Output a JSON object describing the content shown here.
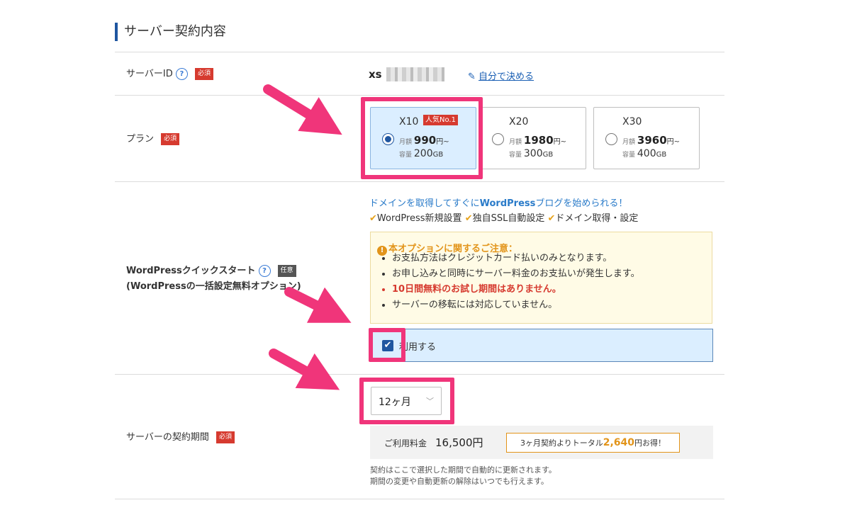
{
  "section": {
    "title": "サーバー契約内容"
  },
  "badges": {
    "required": "必須",
    "optional": "任意",
    "help": "?"
  },
  "server_id": {
    "label": "サーバーID",
    "value_prefix": "xs",
    "edit_link": "自分で決める"
  },
  "plan": {
    "label": "プラン",
    "monthly_label": "月額",
    "capacity_label": "容量",
    "price_unit": "円~",
    "capacity_unit": "GB",
    "popular_badge": "人気No.1",
    "selected": "X10",
    "options": [
      {
        "name": "X10",
        "price": "990",
        "capacity": "200"
      },
      {
        "name": "X20",
        "price": "1980",
        "capacity": "300"
      },
      {
        "name": "X30",
        "price": "3960",
        "capacity": "400"
      }
    ]
  },
  "wordpress": {
    "label": "WordPressクイックスタート",
    "sublabel": "(WordPressの一括設定無料オプション)",
    "headline_pre": "ドメインを取得してすぐに",
    "headline_bold": "WordPress",
    "headline_post": "ブログを始められる！",
    "features": [
      "WordPress新規設置",
      "独自SSL自動設定",
      "ドメイン取得・設定"
    ],
    "notice_title": "本オプションに関するご注意：",
    "notice_items": [
      "お支払方法はクレジットカード払いのみとなります。",
      "お申し込みと同時にサーバー料金のお支払いが発生します。",
      "10日間無料のお試し期間はありません。",
      "サーバーの移転には対応していません。"
    ],
    "use_label": "利用する",
    "use_checked": true
  },
  "contract": {
    "label": "サーバーの契約期間",
    "selected_period": "12ヶ月",
    "fee_label": "ご利用料金",
    "fee_amount": "16,500円",
    "promo_pre": "3ヶ月契約よりトータル",
    "promo_amount": "2,640",
    "promo_post": "円お得！",
    "renew_note_1": "契約はここで選択した期間で自動的に更新されます。",
    "renew_note_2": "期間の変更や自動更新の解除はいつでも行えます。"
  },
  "colors": {
    "accent": "#1f56a0",
    "highlight": "#f0357a",
    "required": "#d63a2f",
    "warning": "#e2941a"
  }
}
